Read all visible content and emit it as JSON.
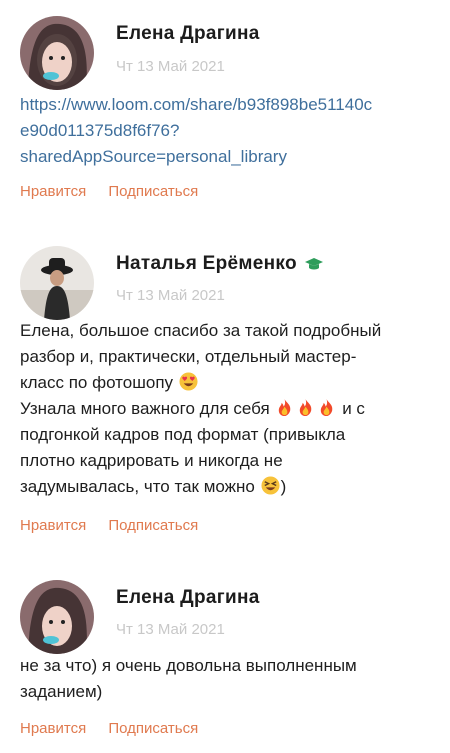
{
  "comments": [
    {
      "author": "Елена Драгина",
      "date": "Чт 13 Май 2021",
      "link_lines": [
        "https://www.loom.com/share/b93f898be51140c",
        "e90d011375d8f6f76?",
        "sharedAppSource=personal_library"
      ],
      "like_label": "Нравится",
      "subscribe_label": "Подписаться"
    },
    {
      "author": "Наталья Ерёменко",
      "badge_icon": "graduation-cap-icon",
      "date": "Чт 13 Май 2021",
      "lines": [
        "Елена, большое спасибо за такой подробный",
        "разбор и, практически, отдельный мастер-",
        "класс по фотошопу",
        "Узнала много важного для себя",
        "и с",
        "подгонкой кадров под формат (привыкла",
        "плотно кадрировать и никогда не",
        "задумывалась, что так можно",
        ")"
      ],
      "like_label": "Нравится",
      "subscribe_label": "Подписаться"
    },
    {
      "author": "Елена Драгина",
      "date": "Чт 13 Май 2021",
      "lines": [
        "не за что) я очень довольна выполненным",
        "заданием)"
      ],
      "like_label": "Нравится",
      "subscribe_label": "Подписаться"
    }
  ],
  "colors": {
    "action": "#e07a4f",
    "link": "#3f6f9c",
    "date": "#c8c8c8",
    "badge": "#2e9d5b"
  }
}
